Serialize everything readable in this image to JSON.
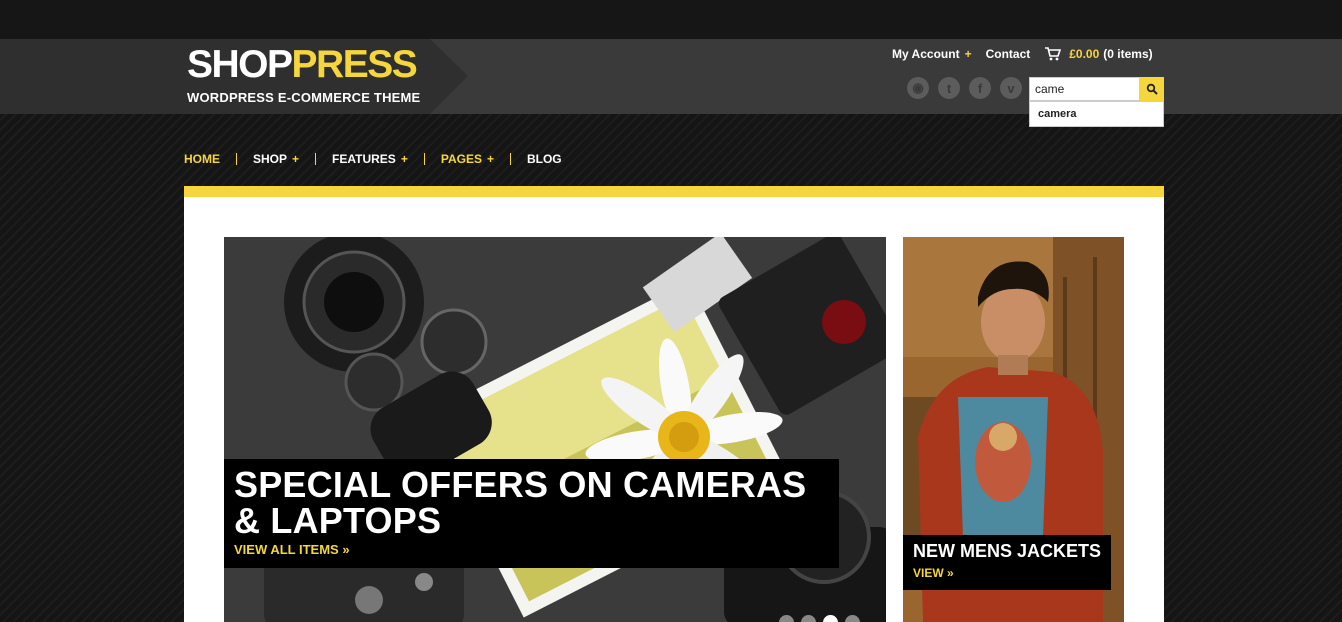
{
  "brand": {
    "name_part1": "SHOP",
    "name_part2": "PRESS",
    "tagline": "WORDPRESS E-COMMERCE THEME",
    "accent_color": "#f5d63d"
  },
  "header": {
    "my_account": "My Account",
    "plus": "+",
    "contact": "Contact",
    "cart_total": "£0.00",
    "cart_count": "(0 items)",
    "social": [
      {
        "name": "rss-icon",
        "glyph": "◉"
      },
      {
        "name": "twitter-icon",
        "glyph": "t"
      },
      {
        "name": "facebook-icon",
        "glyph": "f"
      },
      {
        "name": "vimeo-icon",
        "glyph": "v"
      }
    ],
    "search_value": "came",
    "search_suggestion": "camera"
  },
  "nav": {
    "items": [
      {
        "label": "HOME",
        "has_plus": false,
        "highlight": true
      },
      {
        "label": "SHOP",
        "has_plus": true,
        "highlight": false
      },
      {
        "label": "FEATURES",
        "has_plus": true,
        "highlight": false
      },
      {
        "label": "PAGES",
        "has_plus": true,
        "highlight": true
      },
      {
        "label": "BLOG",
        "has_plus": false,
        "highlight": false
      }
    ]
  },
  "hero": {
    "title": "SPECIAL OFFERS ON CAMERAS & LAPTOPS",
    "link": "VIEW ALL ITEMS »",
    "active_slide": 3,
    "slide_count": 4
  },
  "side_banner": {
    "title": "NEW MENS JACKETS",
    "link": "VIEW »"
  }
}
